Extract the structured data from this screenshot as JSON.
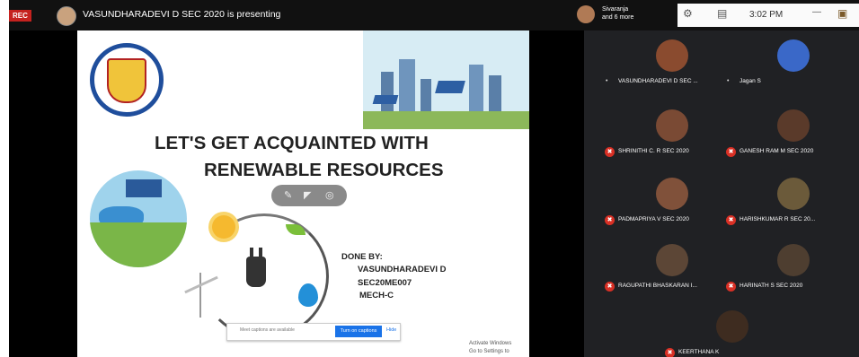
{
  "topbar": {
    "rec_label": "REC",
    "presenting_text": "VASUNDHARADEVI D SEC 2020 is presenting",
    "others_line1": "Sivaranja",
    "others_line2": "and 6 more",
    "time": "3:02 PM"
  },
  "slide": {
    "title_line1": "LET'S GET ACQUAINTED WITH",
    "title_line2": "RENEWABLE RESOURCES",
    "done_by_label": "DONE BY:",
    "done_by_name": "VASUNDHARADEVI D",
    "done_by_id": "SEC20ME007",
    "done_by_dept": "MECH-C",
    "caption_prompt": "Meet captions are available",
    "caption_button": "Turn on captions",
    "caption_dismiss": "Hide",
    "watermark_line1": "Activate Windows",
    "watermark_line2": "Go to Settings to activate Windows."
  },
  "participants": [
    {
      "name": "VASUNDHARADEVI D SEC ...",
      "muted": false,
      "avatar_color": "#8a4b2f"
    },
    {
      "name": "Jagan S",
      "muted": false,
      "avatar_color": "#3a68c8"
    },
    {
      "name": "SHRINITHI C. R SEC 2020",
      "muted": true,
      "avatar_color": "#7a4a34"
    },
    {
      "name": "GANESH RAM M SEC 2020",
      "muted": true,
      "avatar_color": "#5a3a2a"
    },
    {
      "name": "PADMAPRIYA V SEC 2020",
      "muted": true,
      "avatar_color": "#80513a"
    },
    {
      "name": "HARISHKUMAR R SEC 20...",
      "muted": true,
      "avatar_color": "#6b5a3a"
    },
    {
      "name": "RAGUPATHI BHASKARAN I...",
      "muted": true,
      "avatar_color": "#5c4636"
    },
    {
      "name": "HARINATH S SEC 2020",
      "muted": true,
      "avatar_color": "#4e3e30"
    },
    {
      "name": "KEERTHANA K",
      "muted": true,
      "avatar_color": "#3e2c20"
    }
  ],
  "colors": {
    "meet_bg": "#202124",
    "accent": "#1a73e8",
    "mute_red": "#d93025"
  }
}
